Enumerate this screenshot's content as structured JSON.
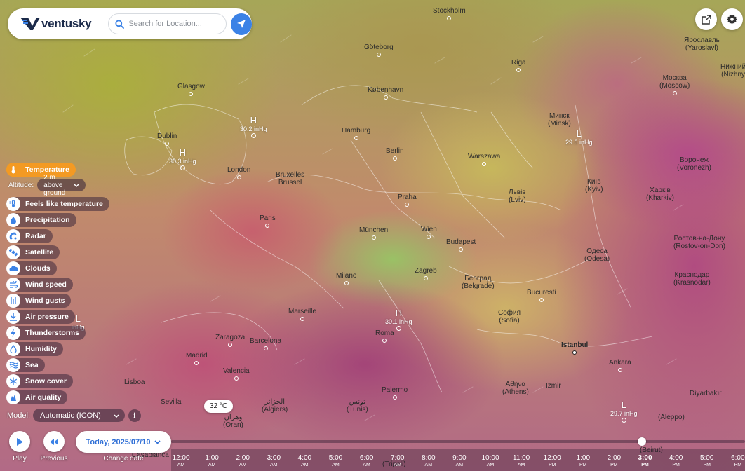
{
  "app": {
    "logo_text": "ventusky",
    "search_placeholder": "Search for Location..."
  },
  "map": {
    "cities": [
      {
        "name": "Stockholm"
      },
      {
        "name": "Göteborg"
      },
      {
        "name": "Riga"
      },
      {
        "name": "København"
      },
      {
        "name": "Glasgow"
      },
      {
        "name": "Dublin"
      },
      {
        "name": "Hamburg"
      },
      {
        "name": "Berlin"
      },
      {
        "name": "Warszawa"
      },
      {
        "name": "Минск",
        "alt": "(Minsk)"
      },
      {
        "name": "Москва",
        "alt": "(Moscow)"
      },
      {
        "name": "Ярославль",
        "alt": "(Yaroslavl)"
      },
      {
        "name": "Нижний",
        "alt": "(Nizhny"
      },
      {
        "name": "London"
      },
      {
        "name": "Bruxelles",
        "alt": "Brussel"
      },
      {
        "name": "Praha"
      },
      {
        "name": "Львів",
        "alt": "(Lviv)"
      },
      {
        "name": "Київ",
        "alt": "(Kyiv)"
      },
      {
        "name": "Воронеж",
        "alt": "(Voronezh)"
      },
      {
        "name": "Харків",
        "alt": "(Kharkiv)"
      },
      {
        "name": "Paris"
      },
      {
        "name": "München"
      },
      {
        "name": "Wien"
      },
      {
        "name": "Budapest"
      },
      {
        "name": "Ростов-на-Дону",
        "alt": "(Rostov-on-Don)"
      },
      {
        "name": "Одеса",
        "alt": "(Odesa)"
      },
      {
        "name": "Zagreb"
      },
      {
        "name": "Milano"
      },
      {
        "name": "Београд",
        "alt": "(Belgrade)"
      },
      {
        "name": "Bucuresti"
      },
      {
        "name": "Краснодар",
        "alt": "(Krasnodar)"
      },
      {
        "name": "Marseille"
      },
      {
        "name": "София",
        "alt": "(Sofia)"
      },
      {
        "name": "Roma"
      },
      {
        "name": "Zaragoza"
      },
      {
        "name": "Barcelona"
      },
      {
        "name": "Istanbul"
      },
      {
        "name": "Madrid"
      },
      {
        "name": "Valencia"
      },
      {
        "name": "Ankara"
      },
      {
        "name": "Lisboa"
      },
      {
        "name": "Αθήνα",
        "alt": "(Athens)"
      },
      {
        "name": "Izmir"
      },
      {
        "name": "Palermo"
      },
      {
        "name": "Sevilla"
      },
      {
        "name": "الجزائر",
        "alt": "(Algiers)"
      },
      {
        "name": "تونس",
        "alt": "(Tunis)"
      },
      {
        "name": "وهران",
        "alt": "(Oran)"
      },
      {
        "name": "Diyarbakır"
      },
      {
        "name": "Casablanca"
      },
      {
        "name": "(Tripoli)"
      },
      {
        "name": "(Beirut)"
      },
      {
        "name": "(Aleppo)"
      }
    ],
    "pressure_centers": [
      {
        "letter": "H",
        "value": "30.2 inHg"
      },
      {
        "letter": "H",
        "value": "30.3 inHg"
      },
      {
        "letter": "L",
        "value": "29.6 inHg"
      },
      {
        "letter": "H",
        "value": "30.1 inHg"
      },
      {
        "letter": "L",
        "value": "29.7 inHg"
      },
      {
        "letter": "L",
        "value": "inHg"
      }
    ],
    "temperature_bubble": "32 °C"
  },
  "layers": {
    "active": "Temperature",
    "altitude_label": "Altitude:",
    "altitude_value": "2 m above ground",
    "items": [
      {
        "label": "Temperature",
        "icon": "thermometer-icon"
      },
      {
        "label": "Feels like temperature",
        "icon": "feels-like-icon"
      },
      {
        "label": "Precipitation",
        "icon": "raindrop-icon"
      },
      {
        "label": "Radar",
        "icon": "radar-icon"
      },
      {
        "label": "Satellite",
        "icon": "satellite-icon"
      },
      {
        "label": "Clouds",
        "icon": "cloud-icon"
      },
      {
        "label": "Wind speed",
        "icon": "wind-icon"
      },
      {
        "label": "Wind gusts",
        "icon": "wind-gust-icon"
      },
      {
        "label": "Air pressure",
        "icon": "pressure-icon"
      },
      {
        "label": "Thunderstorms",
        "icon": "lightning-icon"
      },
      {
        "label": "Humidity",
        "icon": "humidity-icon"
      },
      {
        "label": "Sea",
        "icon": "wave-icon"
      },
      {
        "label": "Snow cover",
        "icon": "snowflake-icon"
      },
      {
        "label": "Air quality",
        "icon": "air-quality-icon"
      }
    ]
  },
  "model": {
    "label": "Model:",
    "value": "Automatic (ICON)",
    "info": "i"
  },
  "controls": {
    "play_label": "Play",
    "previous_label": "Previous",
    "change_date_label": "Change date",
    "date_value": "Today, 2025/07/10"
  },
  "timeline": {
    "progress": 0.82,
    "current_index": 15,
    "ticks": [
      {
        "time": "12:00",
        "ampm": "AM"
      },
      {
        "time": "1:00",
        "ampm": "AM"
      },
      {
        "time": "2:00",
        "ampm": "AM"
      },
      {
        "time": "3:00",
        "ampm": "AM"
      },
      {
        "time": "4:00",
        "ampm": "AM"
      },
      {
        "time": "5:00",
        "ampm": "AM"
      },
      {
        "time": "6:00",
        "ampm": "AM"
      },
      {
        "time": "7:00",
        "ampm": "AM"
      },
      {
        "time": "8:00",
        "ampm": "AM"
      },
      {
        "time": "9:00",
        "ampm": "AM"
      },
      {
        "time": "10:00",
        "ampm": "AM"
      },
      {
        "time": "11:00",
        "ampm": "AM"
      },
      {
        "time": "12:00",
        "ampm": "PM"
      },
      {
        "time": "1:00",
        "ampm": "PM"
      },
      {
        "time": "2:00",
        "ampm": "PM"
      },
      {
        "time": "3:00",
        "ampm": "PM"
      },
      {
        "time": "4:00",
        "ampm": "PM"
      },
      {
        "time": "5:00",
        "ampm": "PM"
      },
      {
        "time": "6:00",
        "ampm": "PM"
      }
    ]
  },
  "colors": {
    "accent_blue": "#3b82e6",
    "active_layer_orange": "#f39a23",
    "logo_dark": "#1b2a4a"
  }
}
